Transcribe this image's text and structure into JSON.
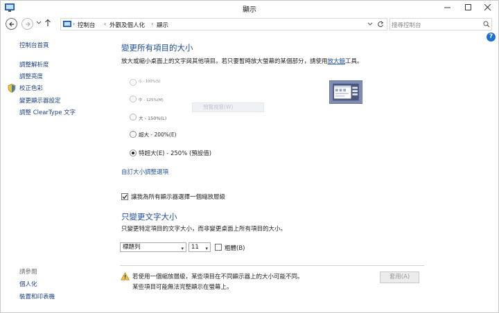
{
  "window": {
    "title": "顯示"
  },
  "address": {
    "breadcrumbs": [
      "控制台",
      "外觀及個人化",
      "顯示"
    ],
    "search_placeholder": "搜尋控制台"
  },
  "sidebar": {
    "top_links": [
      "控制台首頁",
      "調整解析度",
      "調整亮度",
      "校正色彩",
      "變更顯示器設定",
      "調整 ClearType 文字"
    ],
    "see_also_heading": "請參閱",
    "bottom_links": [
      "個人化",
      "裝置和印表機"
    ]
  },
  "main": {
    "heading": "變更所有項目的大小",
    "description_prefix": "放大或縮小桌面上的文字與其他項目。若只要暫時放大螢幕的某個部分，請使用",
    "description_link": "放大鏡",
    "description_suffix": "工具。",
    "size_options": [
      {
        "label": "小 - 100%(S)",
        "selected": false
      },
      {
        "label": "中 - 125%(M)",
        "selected": false
      },
      {
        "label": "大 - 150%(L)",
        "selected": false
      },
      {
        "label": "超大 - 200%(E)",
        "selected": false
      },
      {
        "label": "特超大(E) - 250% (預設值)",
        "selected": true
      }
    ],
    "preview_label": "預覽視窗(W)",
    "custom_size_link": "自訂大小調整選項",
    "per_display_scaling_checkbox": {
      "label": "讓我為所有顯示器選擇一個縮放層級",
      "checked": true
    },
    "text_heading": "只變更文字大小",
    "text_description": "只變更特定項目的文字大小，而非變更桌面上所有項目的大小。",
    "text_item_select": "標題列",
    "text_size_select": "11",
    "bold_checkbox": {
      "label": "粗體(B)",
      "checked": false
    },
    "warning_line1": "若使用一個縮放層級，某些項目在不同顯示器上的大小可能不同。",
    "warning_line2": "某些項目可能無法完整顯示在螢幕上。",
    "apply_button": "套用(A)"
  },
  "colors": {
    "link": "#1e4e9b",
    "heading": "#1e4e9b",
    "help": "#1e6fd1"
  }
}
